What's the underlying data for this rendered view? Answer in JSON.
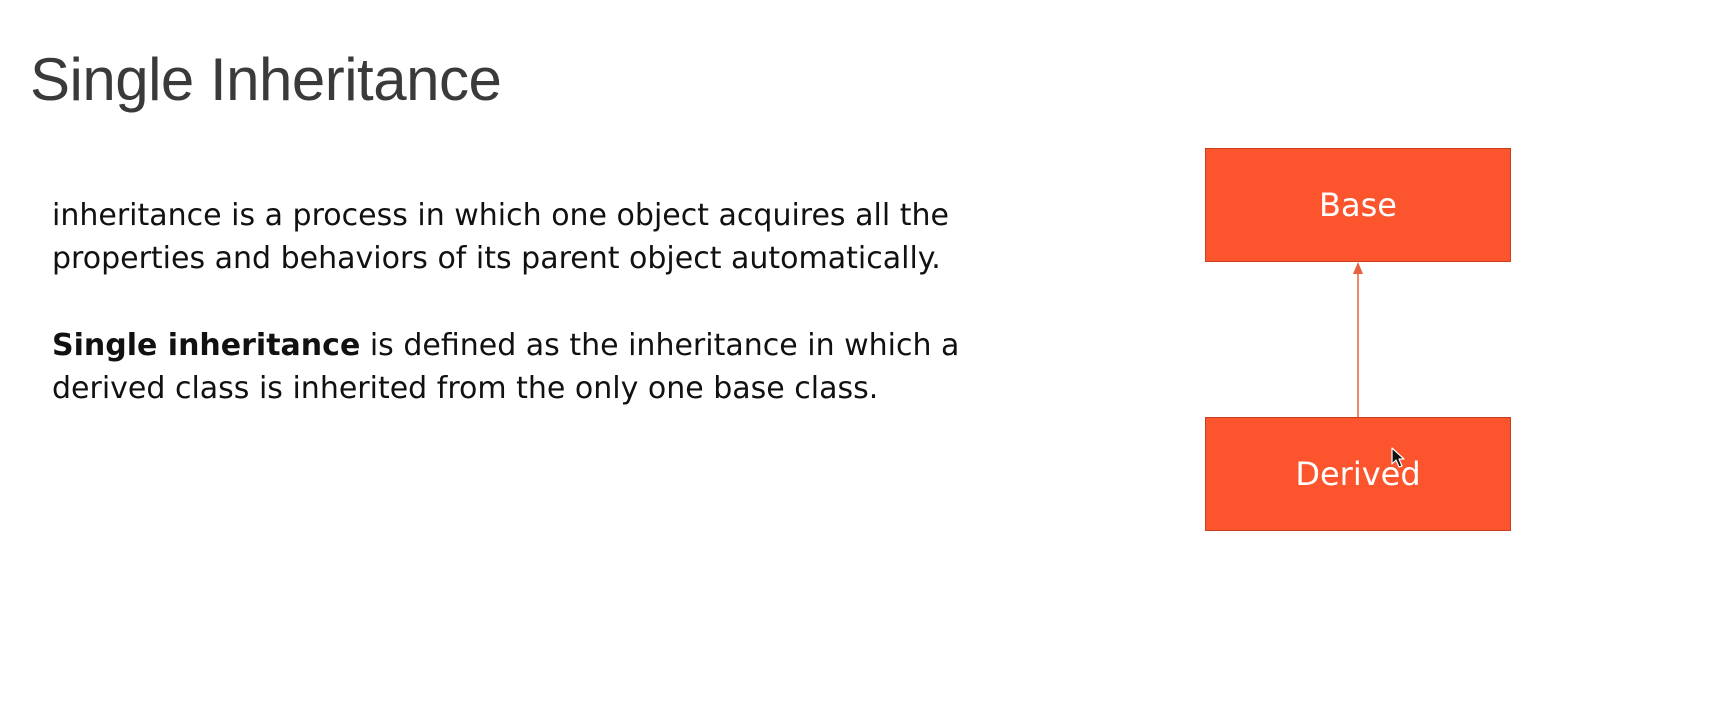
{
  "slide": {
    "title": "Single Inheritance",
    "paragraph1": "inheritance is a process in which one object acquires all the properties and behaviors of its parent object automatically.",
    "paragraph2": {
      "term": "Single inheritance",
      "rest": " is defined as the inheritance in which a derived class is inherited from the only one base class."
    }
  },
  "diagram": {
    "base_label": "Base",
    "derived_label": "Derived",
    "box_color": "#fc542c",
    "arrow_color": "#e8603e",
    "arrow_direction": "derived-to-base"
  }
}
